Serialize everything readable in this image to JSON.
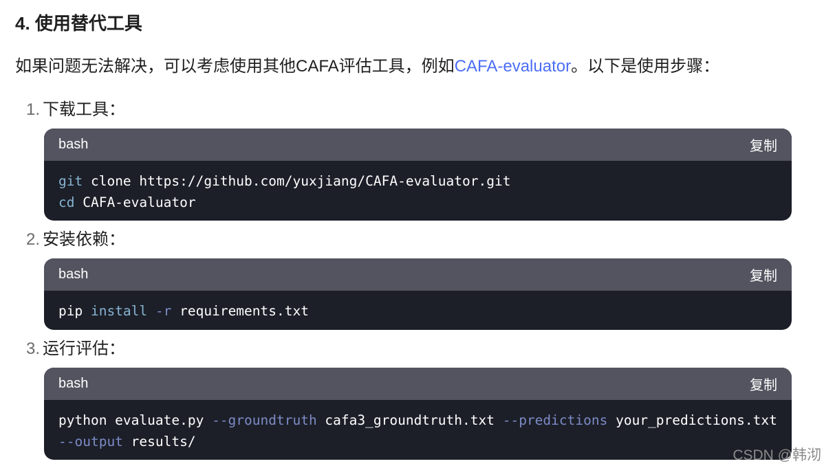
{
  "heading": "4. 使用替代工具",
  "intro": {
    "before": "如果问题无法解决，可以考虑使用其他CAFA评估工具，例如",
    "link": "CAFA-evaluator",
    "after": "。以下是使用步骤："
  },
  "steps": [
    {
      "number": "1.",
      "label": "下载工具：",
      "code": {
        "lang": "bash",
        "copy_label": "复制",
        "lines": [
          [
            {
              "type": "cmd",
              "text": "git"
            },
            {
              "type": "plain",
              "text": " clone https://github.com/yuxjiang/CAFA-evaluator.git"
            }
          ],
          [
            {
              "type": "cmd",
              "text": "cd"
            },
            {
              "type": "plain",
              "text": " CAFA-evaluator"
            }
          ]
        ]
      }
    },
    {
      "number": "2.",
      "label": "安装依赖：",
      "code": {
        "lang": "bash",
        "copy_label": "复制",
        "lines": [
          [
            {
              "type": "plain",
              "text": "pip "
            },
            {
              "type": "cmd",
              "text": "install"
            },
            {
              "type": "plain",
              "text": " "
            },
            {
              "type": "flag",
              "text": "-r"
            },
            {
              "type": "plain",
              "text": " requirements.txt"
            }
          ]
        ]
      }
    },
    {
      "number": "3.",
      "label": "运行评估：",
      "code": {
        "lang": "bash",
        "copy_label": "复制",
        "lines": [
          [
            {
              "type": "plain",
              "text": "python evaluate.py "
            },
            {
              "type": "flag",
              "text": "--groundtruth"
            },
            {
              "type": "plain",
              "text": " cafa3_groundtruth.txt "
            },
            {
              "type": "flag",
              "text": "--predictions"
            },
            {
              "type": "plain",
              "text": " your_predictions.txt "
            },
            {
              "type": "flag",
              "text": "--output"
            },
            {
              "type": "plain",
              "text": " results/"
            }
          ]
        ]
      }
    }
  ],
  "watermark": "CSDN @韩沏"
}
